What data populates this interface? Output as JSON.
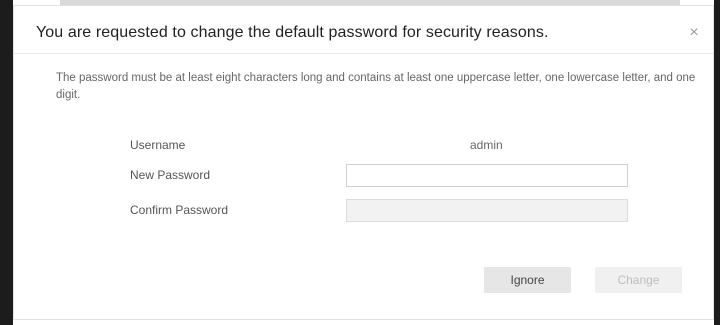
{
  "dialog": {
    "title": "You are requested to change the default password for security reasons.",
    "close_glyph": "×",
    "notice": "The password must be at least eight characters long and contains at least one uppercase letter, one lowercase letter, and one digit."
  },
  "form": {
    "username_label": "Username",
    "username_value": "admin",
    "new_password_label": "New Password",
    "new_password_value": "",
    "confirm_password_label": "Confirm Password",
    "confirm_password_value": ""
  },
  "buttons": {
    "ignore_label": "Ignore",
    "change_label": "Change"
  },
  "icons": {
    "close": "close-icon"
  },
  "colors": {
    "ignore_button_bg": "#e6e6e6",
    "change_button_bg_disabled": "#f0f0f0",
    "confirm_input_bg_disabled": "#f2f2f2"
  }
}
